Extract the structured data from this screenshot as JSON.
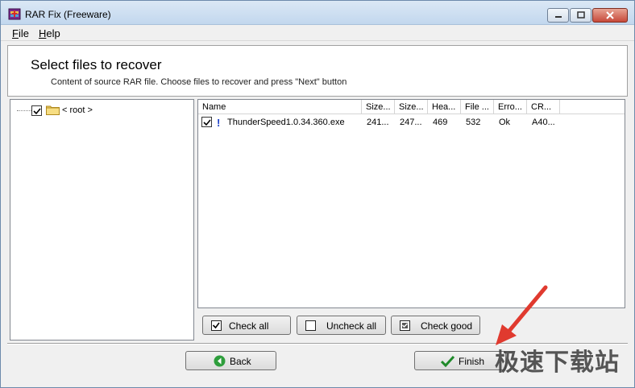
{
  "window": {
    "title": "RAR Fix (Freeware)"
  },
  "menu": {
    "file_key": "F",
    "file_rest": "ile",
    "help_key": "H",
    "help_rest": "elp"
  },
  "header": {
    "title": "Select files to recover",
    "subtitle": "Content of source RAR file. Choose files to recover and press \"Next\" button"
  },
  "tree": {
    "root_label": "< root >",
    "root_checked": true
  },
  "list": {
    "columns": [
      "Name",
      "Size...",
      "Size...",
      "Hea...",
      "File ...",
      "Erro...",
      "CR..."
    ],
    "rows": [
      {
        "checked": true,
        "flag": "!",
        "name": "ThunderSpeed1.0.34.360.exe",
        "size1": "241...",
        "size2": "247...",
        "header": "469",
        "file": "532",
        "error": "Ok",
        "crc": "A40..."
      }
    ]
  },
  "buttons": {
    "check_all": "Check all",
    "uncheck_all": "Uncheck all",
    "check_good": "Check good",
    "back": "Back",
    "finish": "Finish"
  },
  "watermark": "极速下载站",
  "colors": {
    "arrow": "#e03a2f",
    "back_icon": "#2e9e3c",
    "finish_check": "#1f8a2a",
    "flag": "#1a3ec8"
  }
}
